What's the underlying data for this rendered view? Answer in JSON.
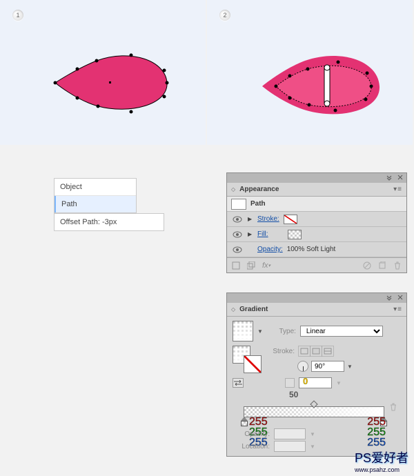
{
  "previews": [
    {
      "badge": "1"
    },
    {
      "badge": "2"
    }
  ],
  "wizard": {
    "items": [
      "Object",
      "Path"
    ],
    "offset_label": "Offset Path: -3px"
  },
  "appearance": {
    "title": "Appearance",
    "object_label": "Path",
    "rows": {
      "stroke_label": "Stroke:",
      "fill_label": "Fill:",
      "opacity_label": "Opacity:",
      "opacity_value": "100% Soft Light"
    }
  },
  "gradient": {
    "title": "Gradient",
    "type_label": "Type:",
    "type_value": "Linear",
    "stroke_label": "Stroke:",
    "angle_value": "90°",
    "aspect_value": "",
    "midpoint": "50",
    "stop_opacity_label": "0",
    "opacity_label": "Opacity:",
    "location_label": "Location:",
    "stops": [
      {
        "r": "255",
        "g": "255",
        "b": "255"
      },
      {
        "r": "255",
        "g": "255",
        "b": "255"
      }
    ]
  },
  "watermark": "PS爱好者 www.psahz.com"
}
